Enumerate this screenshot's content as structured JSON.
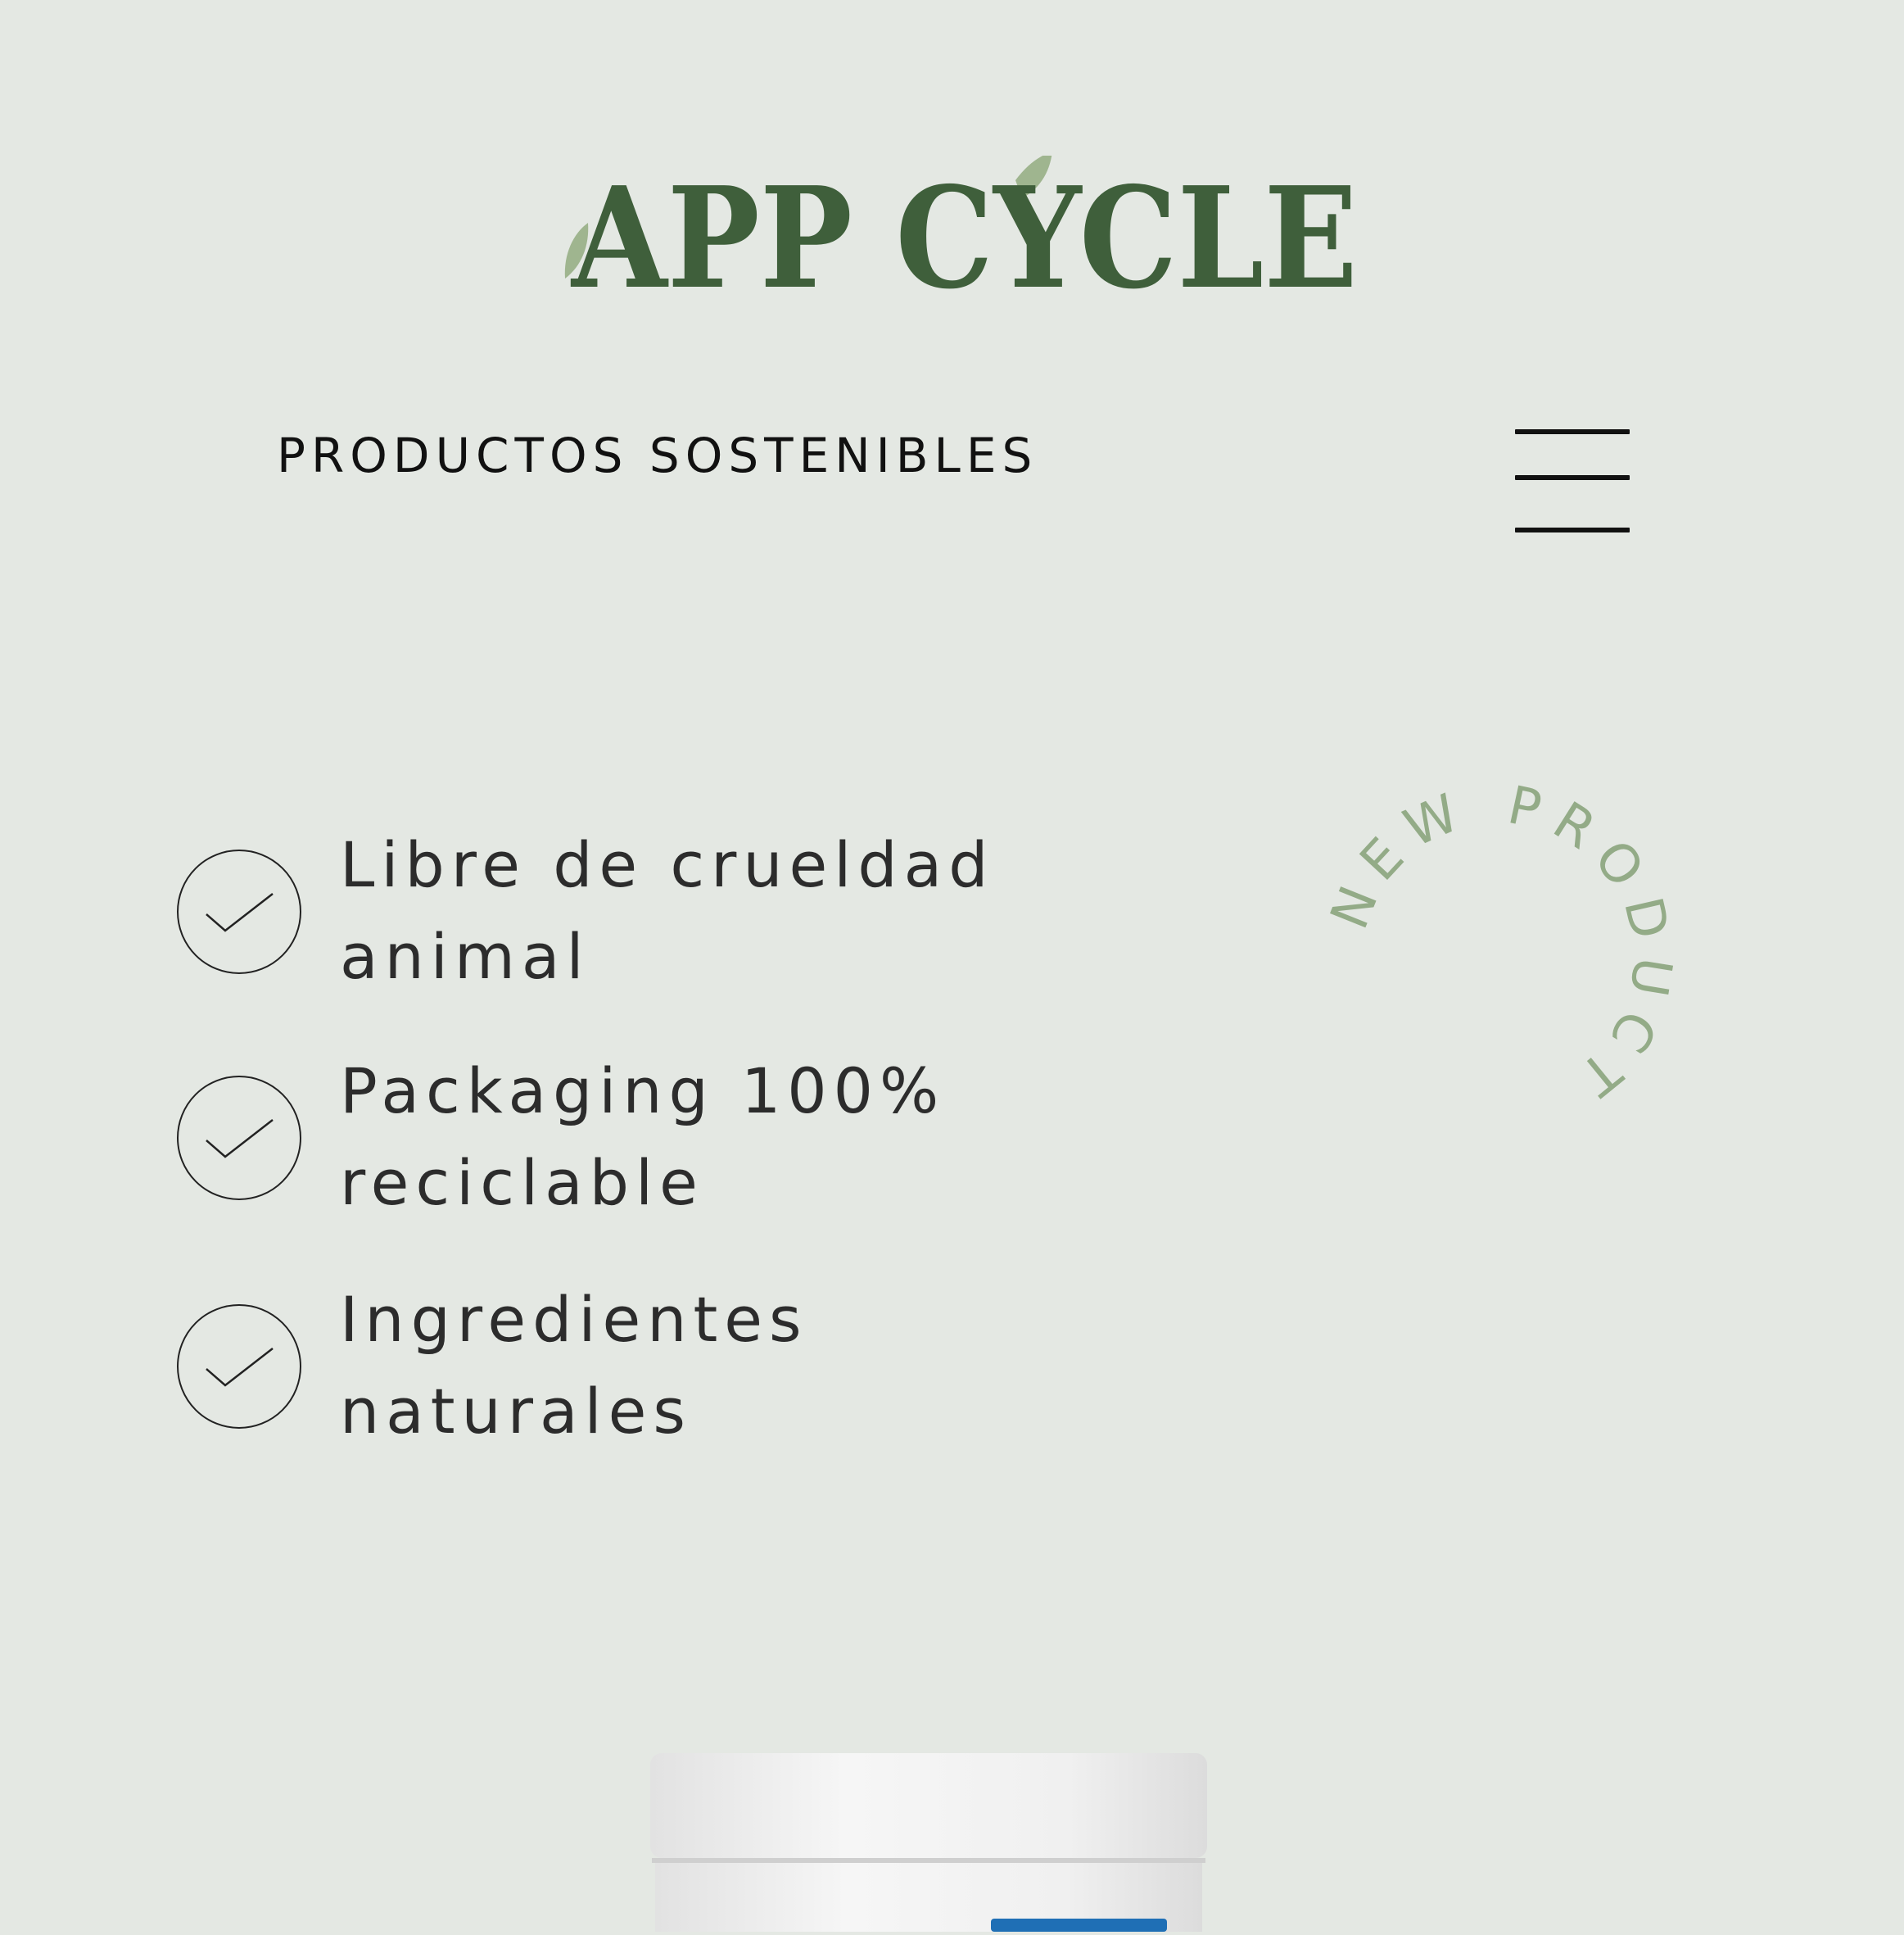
{
  "brand": {
    "logo_text": "APP CYCLE",
    "primary_color": "#3f5f3b",
    "leaf_color": "#9fb58f"
  },
  "header": {
    "subtitle": "PRODUCTOS SOSTENIBLES",
    "menu_icon": "hamburger-menu-icon"
  },
  "features": [
    {
      "label": "Libre de crueldad\nanimal",
      "icon": "check-circle-icon"
    },
    {
      "label": "Packaging 100%\nreciclable",
      "icon": "check-circle-icon"
    },
    {
      "label": "Ingredientes\nnaturales",
      "icon": "check-circle-icon"
    }
  ],
  "badge": {
    "text": "NEW PRODUCT",
    "color": "#93ab87"
  },
  "product": {
    "image": "product-jar"
  }
}
